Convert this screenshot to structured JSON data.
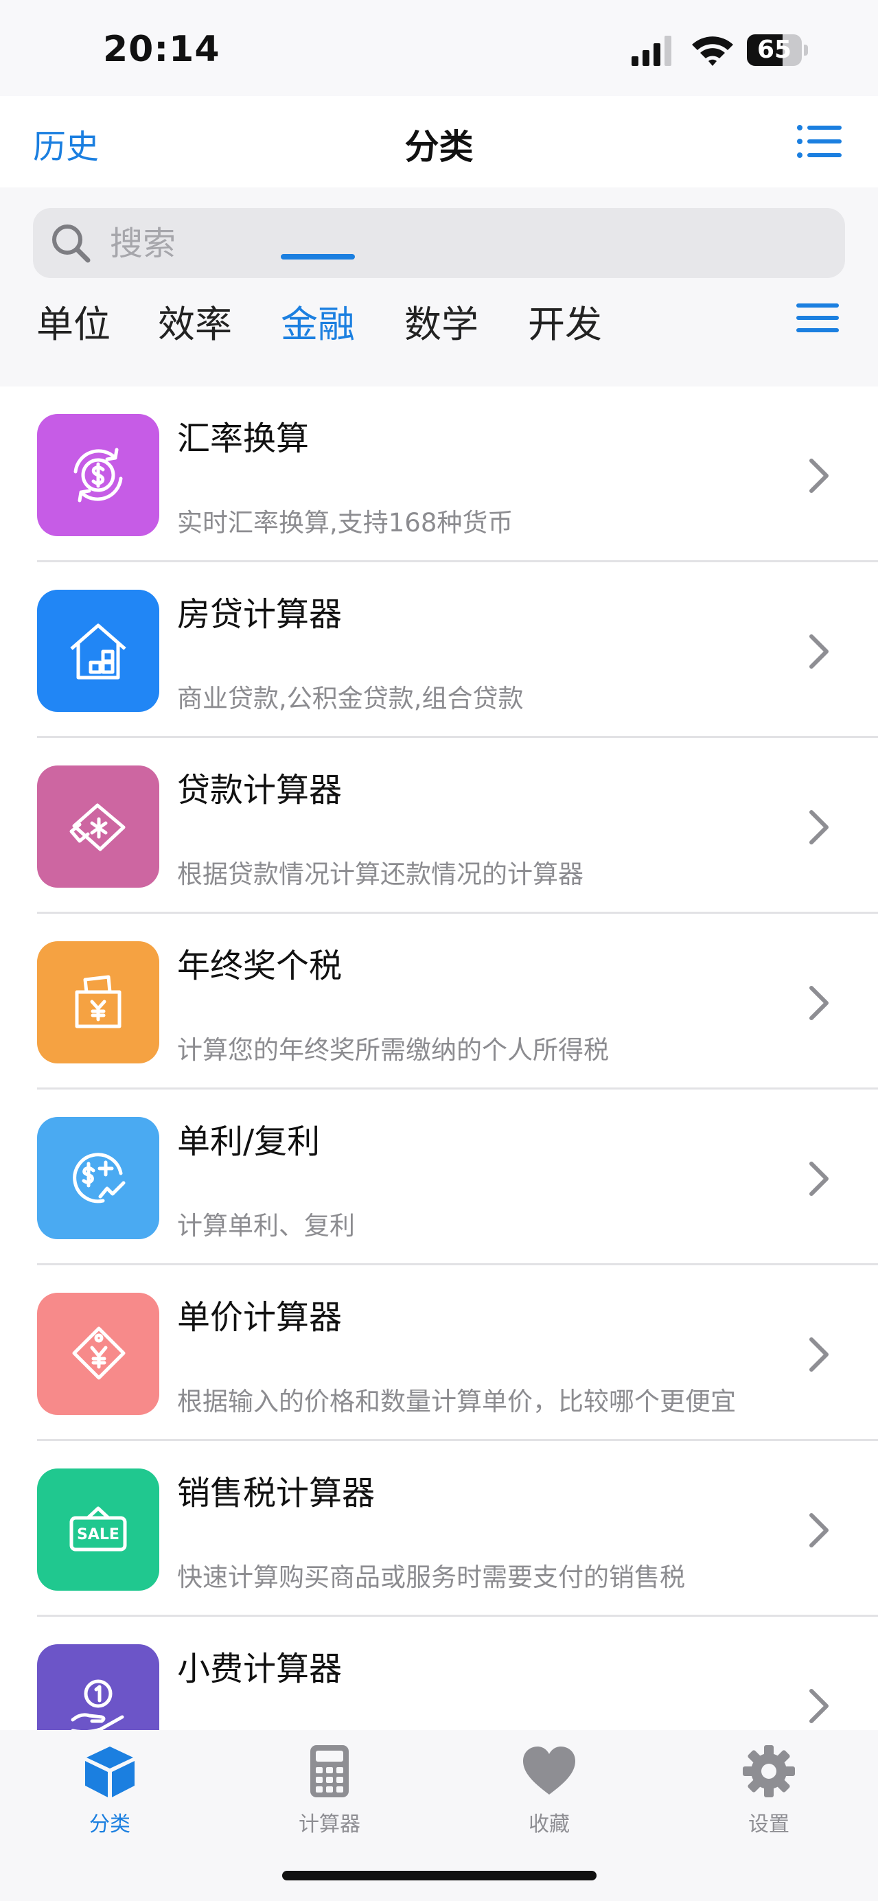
{
  "status": {
    "time": "20:14",
    "battery": "65",
    "battery_level": 0.65
  },
  "nav": {
    "left_label": "历史",
    "title": "分类"
  },
  "search": {
    "placeholder": "搜索"
  },
  "categories": [
    "单位",
    "效率",
    "金融",
    "数学",
    "开发"
  ],
  "active_category": "金融",
  "tools": [
    {
      "title": "汇率换算",
      "desc": "实时汇率换算,支持168种货币",
      "icon": "currency-exchange-icon",
      "color": "#c65ce6"
    },
    {
      "title": "房贷计算器",
      "desc": "商业贷款,公积金贷款,组合贷款",
      "icon": "house-icon",
      "color": "#2186f5"
    },
    {
      "title": "贷款计算器",
      "desc": "根据贷款情况计算还款情况的计算器",
      "icon": "loan-ticket-icon",
      "color": "#cd66a1"
    },
    {
      "title": "年终奖个税",
      "desc": "计算您的年终奖所需缴纳的个人所得税",
      "icon": "bonus-envelope-icon",
      "color": "#f5a242"
    },
    {
      "title": "单利/复利",
      "desc": "计算单利、复利",
      "icon": "interest-growth-icon",
      "color": "#4aaaf2"
    },
    {
      "title": "单价计算器",
      "desc": "根据输入的价格和数量计算单价，比较哪个更便宜",
      "icon": "price-tag-icon",
      "color": "#f78a8a"
    },
    {
      "title": "销售税计算器",
      "desc": "快速计算购买商品或服务时需要支付的销售税",
      "icon": "sale-sign-icon",
      "color": "#20c88f"
    },
    {
      "title": "小费计算器",
      "desc": "",
      "icon": "tip-hand-coin-icon",
      "color": "#6c55c8"
    }
  ],
  "tabbar": [
    {
      "label": "分类",
      "icon": "cube-icon",
      "active": true
    },
    {
      "label": "计算器",
      "icon": "calculator-icon",
      "active": false
    },
    {
      "label": "收藏",
      "icon": "heart-icon",
      "active": false
    },
    {
      "label": "设置",
      "icon": "gear-icon",
      "active": false
    }
  ],
  "colors": {
    "accent": "#1b7fe0",
    "secondary_text": "#8c8c90",
    "inactive_tab": "#8e8e93"
  }
}
